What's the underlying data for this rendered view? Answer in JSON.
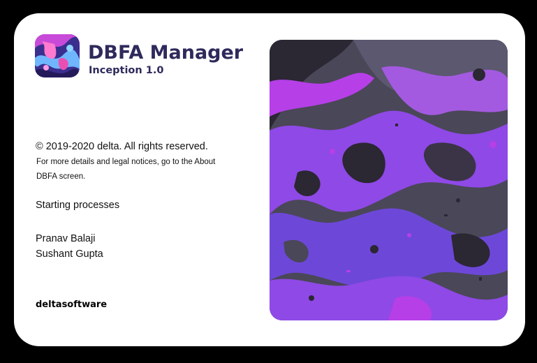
{
  "window": {
    "title": "DBFA Manager",
    "version": "Inception 1.0"
  },
  "legal": {
    "copyright": "© 2019-2020 delta. All rights reserved.",
    "notice": "For more details and legal notices, go to the About DBFA screen."
  },
  "status": {
    "message": "Starting processes"
  },
  "credits": {
    "names": [
      "Pranav Balaji",
      "Sushant Gupta"
    ]
  },
  "brand": {
    "name": "deltasoftware"
  },
  "colors": {
    "title": "#2e2a5c",
    "art_purple": "#8f49e6",
    "art_violet": "#6d48d8",
    "art_magenta": "#b63fe8",
    "art_gray": "#4a4758",
    "art_dark": "#2b2733"
  },
  "icons": {
    "app_icon": "abstract-swirl-icon"
  }
}
